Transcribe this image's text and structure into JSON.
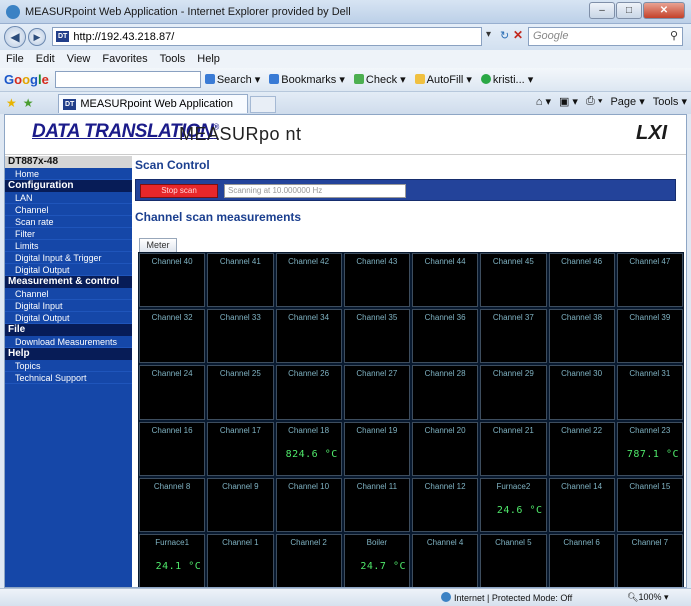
{
  "window": {
    "title": "MEASURpoint Web Application - Internet Explorer provided by Dell"
  },
  "address": {
    "url": "http://192.43.218.87/",
    "search_placeholder": "Google"
  },
  "menu": [
    "File",
    "Edit",
    "View",
    "Favorites",
    "Tools",
    "Help"
  ],
  "gtoolbar": {
    "logo": "Google",
    "items": [
      "Search",
      "Bookmarks",
      "Check",
      "AutoFill",
      "kristi..."
    ]
  },
  "tab": {
    "label": "MEASURpoint Web Application"
  },
  "cmdbar": [
    "Page",
    "Tools"
  ],
  "brand": {
    "logo": "DATA TRANSLATION",
    "product": "MEASURpo nt",
    "lxi": "LXI"
  },
  "sidebar": {
    "title": "DT887x-48",
    "home": "Home",
    "sections": [
      {
        "label": "Configuration",
        "items": [
          "LAN",
          "Channel",
          "Scan rate",
          "Filter",
          "Limits",
          "Digital Input & Trigger",
          "Digital Output"
        ]
      },
      {
        "label": "Measurement & control",
        "items": [
          "Channel",
          "Digital Input",
          "Digital Output"
        ]
      },
      {
        "label": "File",
        "items": [
          "Download Measurements"
        ]
      },
      {
        "label": "Help",
        "items": [
          "Topics",
          "Technical Support"
        ]
      }
    ]
  },
  "main": {
    "scan_title": "Scan Control",
    "stop_label": "Stop scan",
    "status_text": "Scanning at 10.000000 Hz",
    "measurements_title": "Channel scan measurements",
    "meter_tab": "Meter"
  },
  "grid": [
    [
      {
        "name": "Channel 40",
        "value": ""
      },
      {
        "name": "Channel 41",
        "value": ""
      },
      {
        "name": "Channel 42",
        "value": ""
      },
      {
        "name": "Channel 43",
        "value": ""
      },
      {
        "name": "Channel 44",
        "value": ""
      },
      {
        "name": "Channel 45",
        "value": ""
      },
      {
        "name": "Channel 46",
        "value": ""
      },
      {
        "name": "Channel 47",
        "value": ""
      }
    ],
    [
      {
        "name": "Channel 32",
        "value": ""
      },
      {
        "name": "Channel 33",
        "value": ""
      },
      {
        "name": "Channel 34",
        "value": ""
      },
      {
        "name": "Channel 35",
        "value": ""
      },
      {
        "name": "Channel 36",
        "value": ""
      },
      {
        "name": "Channel 37",
        "value": ""
      },
      {
        "name": "Channel 38",
        "value": ""
      },
      {
        "name": "Channel 39",
        "value": ""
      }
    ],
    [
      {
        "name": "Channel 24",
        "value": ""
      },
      {
        "name": "Channel 25",
        "value": ""
      },
      {
        "name": "Channel 26",
        "value": ""
      },
      {
        "name": "Channel 27",
        "value": ""
      },
      {
        "name": "Channel 28",
        "value": ""
      },
      {
        "name": "Channel 29",
        "value": ""
      },
      {
        "name": "Channel 30",
        "value": ""
      },
      {
        "name": "Channel 31",
        "value": ""
      }
    ],
    [
      {
        "name": "Channel 16",
        "value": ""
      },
      {
        "name": "Channel 17",
        "value": ""
      },
      {
        "name": "Channel 18",
        "value": "824.6 °C"
      },
      {
        "name": "Channel 19",
        "value": ""
      },
      {
        "name": "Channel 20",
        "value": ""
      },
      {
        "name": "Channel 21",
        "value": ""
      },
      {
        "name": "Channel 22",
        "value": ""
      },
      {
        "name": "Channel 23",
        "value": "787.1 °C"
      }
    ],
    [
      {
        "name": "Channel 8",
        "value": ""
      },
      {
        "name": "Channel 9",
        "value": ""
      },
      {
        "name": "Channel 10",
        "value": ""
      },
      {
        "name": "Channel 11",
        "value": ""
      },
      {
        "name": "Channel 12",
        "value": ""
      },
      {
        "name": "Furnace2",
        "value": "24.6 °C"
      },
      {
        "name": "Channel 14",
        "value": ""
      },
      {
        "name": "Channel 15",
        "value": ""
      }
    ],
    [
      {
        "name": "Furnace1",
        "value": "24.1 °C"
      },
      {
        "name": "Channel 1",
        "value": ""
      },
      {
        "name": "Channel 2",
        "value": ""
      },
      {
        "name": "Boiler",
        "value": "24.7 °C"
      },
      {
        "name": "Channel 4",
        "value": ""
      },
      {
        "name": "Channel 5",
        "value": ""
      },
      {
        "name": "Channel 6",
        "value": ""
      },
      {
        "name": "Channel 7",
        "value": ""
      }
    ]
  ],
  "statusbar": {
    "zone": "Internet | Protected Mode: Off",
    "zoom": "100%"
  }
}
